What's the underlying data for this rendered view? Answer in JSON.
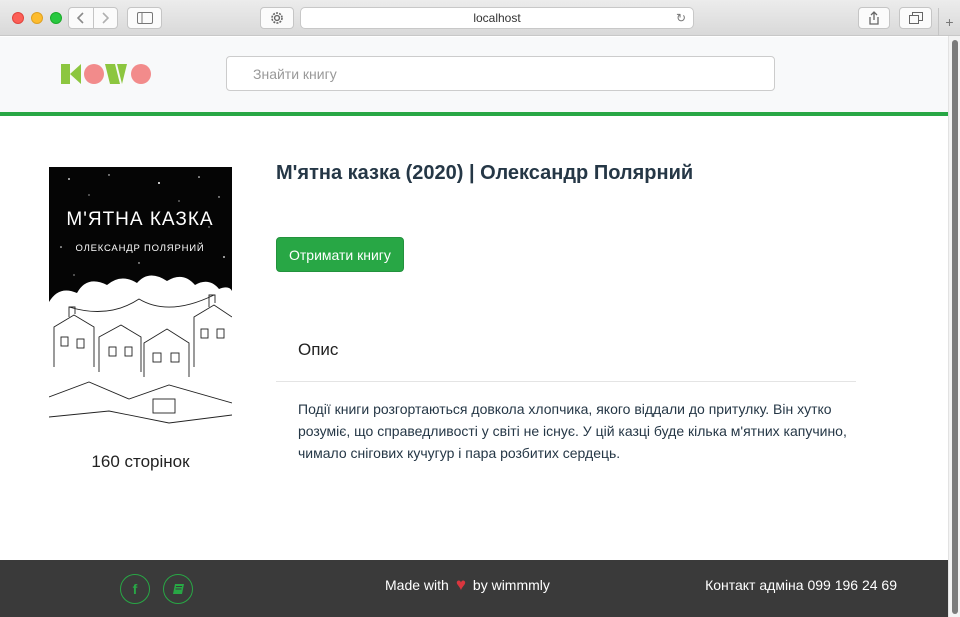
{
  "browser": {
    "url": "localhost",
    "back_icon": "chevron-left-icon",
    "forward_icon": "chevron-right-icon",
    "reload_icon": "reload-icon",
    "new_tab_label": "+"
  },
  "header": {
    "logo_text": "KOWO",
    "search_placeholder": "Знайти книгу"
  },
  "book": {
    "cover_title": "М'ЯТНА КАЗКА",
    "cover_author": "ОЛЕКСАНДР ПОЛЯРНИЙ",
    "pages": "160 сторінок",
    "title": "М'ятна казка (2020) | Олександр Полярний",
    "get_button": "Отримати книгу",
    "description_heading": "Опис",
    "description": "Події книги розгортаються довкола хлопчика, якого віддали до притулку. Він хутко розуміє, що справедливості у світі не існує. У цій казці буде кілька м'ятних капучино, чимало снігових кучугур і пара розбитих сердець."
  },
  "footer": {
    "social_facebook_label": "f",
    "social_book_label": "▮",
    "made_with": "Made with",
    "by": "by wimmmly",
    "contact": "Контакт адміна 099 196 24 69"
  },
  "colors": {
    "accent": "#28a745",
    "footer_bg": "#3a3a3a",
    "heart": "#d9363e",
    "title": "#253746"
  }
}
